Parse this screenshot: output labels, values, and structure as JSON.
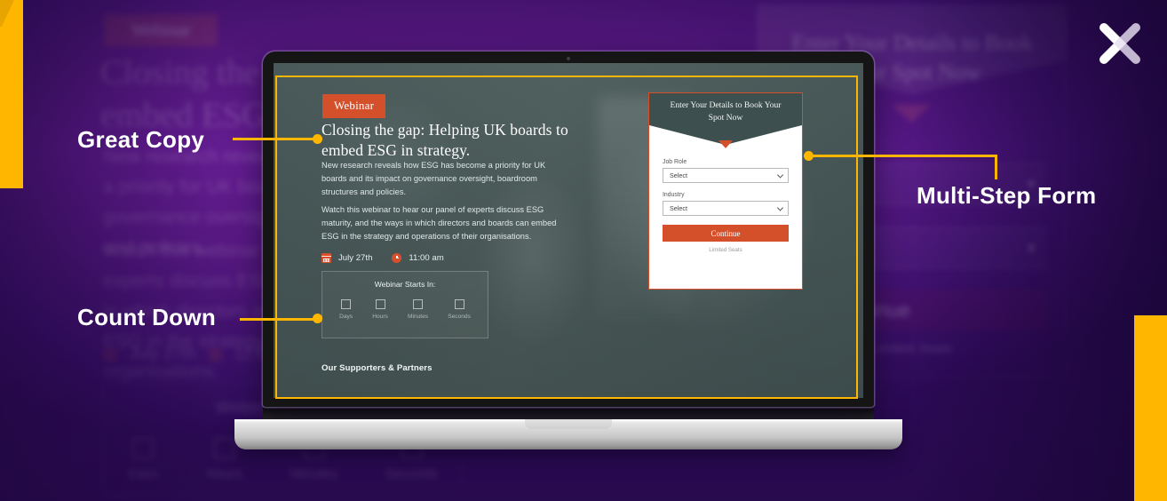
{
  "colors": {
    "accent_yellow": "#ffb600",
    "brand_purple": "#5d1a8a",
    "brand_dark_purple": "#2a0c52",
    "cta_orange": "#d4502a",
    "screen_slate": "#4c5c5c",
    "form_header_slate": "#3d4f4e"
  },
  "logo": {
    "name": "x-logo",
    "alt": "X"
  },
  "callouts": [
    {
      "id": "great-copy",
      "label": "Great Copy"
    },
    {
      "id": "count-down",
      "label": "Count Down"
    },
    {
      "id": "multi-step-form",
      "label": "Multi-Step Form"
    }
  ],
  "webinar_page": {
    "badge": "Webinar",
    "headline": "Closing the gap: Helping UK boards to embed ESG in strategy.",
    "paragraphs": [
      "New research reveals how ESG has become a priority for UK boards and its impact on governance oversight, boardroom structures and policies.",
      "Watch this webinar to hear our panel of experts discuss ESG maturity, and the ways in which directors and boards can embed ESG in the strategy and operations of their organisations."
    ],
    "date": "July 27th",
    "time": "11:00 am",
    "date_icon": "calendar-icon",
    "time_icon": "clock-icon",
    "countdown": {
      "title": "Webinar Starts In:",
      "units": [
        {
          "label": "Days",
          "value": ""
        },
        {
          "label": "Hours",
          "value": ""
        },
        {
          "label": "Minutes",
          "value": ""
        },
        {
          "label": "Seconds",
          "value": ""
        }
      ]
    },
    "supporters_heading": "Our Supporters & Partners",
    "form": {
      "header_title": "Enter Your Details to Book Your Spot Now",
      "fields": [
        {
          "label": "Job Role",
          "value": "Select",
          "placeholder": "Select"
        },
        {
          "label": "Industry",
          "value": "Select",
          "placeholder": "Select"
        }
      ],
      "submit_label": "Continue",
      "footnote": "Limited Seats"
    }
  }
}
